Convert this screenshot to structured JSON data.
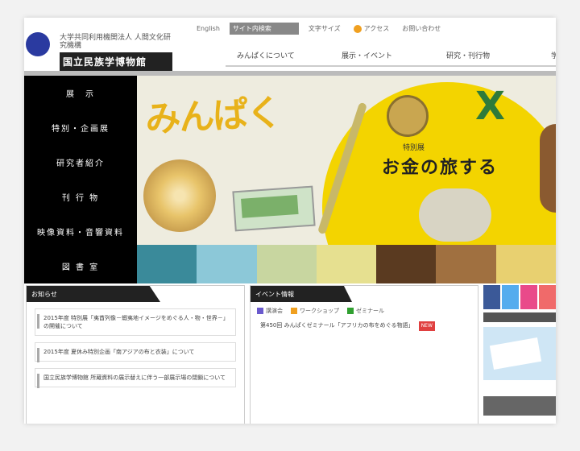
{
  "header": {
    "logo_small": "大学共同利用機関法人 人間文化研究機構",
    "logo_main": "国立民族学博物館",
    "utility": [
      {
        "label": "English"
      },
      {
        "label": "サイト内検索"
      },
      {
        "label": "文字サイズ"
      },
      {
        "label": "アクセス"
      },
      {
        "label": "お問い合わせ"
      }
    ],
    "gnav": [
      {
        "label": "みんぱくについて"
      },
      {
        "label": "展示・イベント"
      },
      {
        "label": "研究・刊行物"
      },
      {
        "label": "学術資料"
      }
    ]
  },
  "leftnav": [
    {
      "label": "展　示"
    },
    {
      "label": "特別・企画展"
    },
    {
      "label": "研究者紹介"
    },
    {
      "label": "刊 行 物"
    },
    {
      "label": "映像資料・音響資料"
    },
    {
      "label": "図 書 室"
    }
  ],
  "banner": {
    "title": "みんぱく",
    "subtitle": "特別展",
    "headline": "お金の旅する"
  },
  "strip_colors": [
    "#3a8a9a",
    "#8cc8d8",
    "#c8d6a0",
    "#e6e090",
    "#5a3a20",
    "#a07040",
    "#e8d070"
  ],
  "news": {
    "tab": "お知らせ",
    "items": [
      {
        "text": "2015年度 特別展「夷酋列像－蝦夷地イメージをめぐる人・物・世界－」の開催について"
      },
      {
        "text": "2015年度 夏休み特別企画「南アジアの布と衣装」について"
      },
      {
        "text": "国立民族学博物館 所蔵資料の展示替えに伴う一部展示場の閉鎖について"
      }
    ]
  },
  "events": {
    "tab": "イベント情報",
    "legend": [
      {
        "label": "講演会",
        "color": "#6a5acd"
      },
      {
        "label": "ワークショップ",
        "color": "#f0a020"
      },
      {
        "label": "ゼミナール",
        "color": "#30a030"
      }
    ],
    "items": [
      {
        "text": "第450回 みんぱくゼミナール「アフリカの布をめぐる物語」",
        "badge": "NEW"
      }
    ]
  },
  "social_colors": [
    "#3b5998",
    "#55acee",
    "#e94a8a",
    "#f06a6a"
  ]
}
